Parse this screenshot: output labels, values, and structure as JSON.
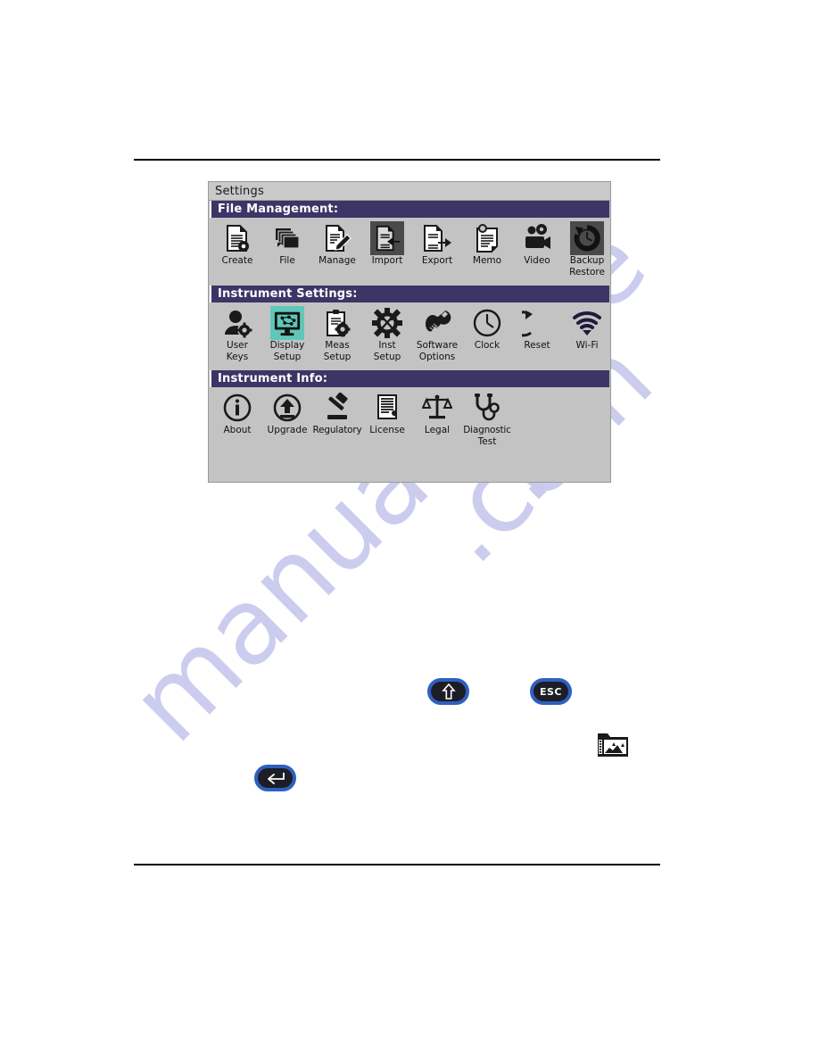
{
  "page": {
    "watermark_line1": "manualshive",
    "watermark_line2": ".com"
  },
  "screen": {
    "title": "Settings",
    "sections": [
      {
        "id": "file-management",
        "header": "File Management:",
        "items": [
          {
            "label": "Create",
            "label2": "",
            "icon": "create-document-icon",
            "state": "normal"
          },
          {
            "label": "File",
            "label2": "",
            "icon": "file-stack-icon",
            "state": "normal"
          },
          {
            "label": "Manage",
            "label2": "",
            "icon": "manage-edit-icon",
            "state": "normal"
          },
          {
            "label": "Import",
            "label2": "",
            "icon": "import-arrow-icon",
            "state": "selected-dark"
          },
          {
            "label": "Export",
            "label2": "",
            "icon": "export-arrow-icon",
            "state": "normal"
          },
          {
            "label": "Memo",
            "label2": "",
            "icon": "memo-pen-icon",
            "state": "normal"
          },
          {
            "label": "Video",
            "label2": "",
            "icon": "video-camera-icon",
            "state": "normal"
          },
          {
            "label": "Backup",
            "label2": "Restore",
            "icon": "backup-restore-icon",
            "state": "selected-dark"
          }
        ]
      },
      {
        "id": "instrument-settings",
        "header": "Instrument Settings:",
        "items": [
          {
            "label": "User",
            "label2": "Keys",
            "icon": "user-gear-icon",
            "state": "normal"
          },
          {
            "label": "Display",
            "label2": "Setup",
            "icon": "display-monitor-icon",
            "state": "selected-teal"
          },
          {
            "label": "Meas",
            "label2": "Setup",
            "icon": "clipboard-gear-icon",
            "state": "normal"
          },
          {
            "label": "Inst",
            "label2": "Setup",
            "icon": "gear-tools-icon",
            "state": "normal"
          },
          {
            "label": "Software",
            "label2": "Options",
            "icon": "hand-wrench-icon",
            "state": "normal"
          },
          {
            "label": "Clock",
            "label2": "",
            "icon": "clock-icon",
            "state": "normal"
          },
          {
            "label": "Reset",
            "label2": "",
            "icon": "reset-arrow-icon",
            "state": "normal"
          },
          {
            "label": "Wi-Fi",
            "label2": "",
            "icon": "wifi-icon",
            "state": "normal"
          }
        ]
      },
      {
        "id": "instrument-info",
        "header": "Instrument Info:",
        "items": [
          {
            "label": "About",
            "label2": "",
            "icon": "info-circle-icon",
            "state": "normal"
          },
          {
            "label": "Upgrade",
            "label2": "",
            "icon": "upgrade-arrow-icon",
            "state": "normal"
          },
          {
            "label": "Regulatory",
            "label2": "",
            "icon": "gavel-icon",
            "state": "normal"
          },
          {
            "label": "License",
            "label2": "",
            "icon": "certificate-icon",
            "state": "normal"
          },
          {
            "label": "Legal",
            "label2": "",
            "icon": "scales-icon",
            "state": "normal"
          },
          {
            "label": "Diagnostic",
            "label2": "Test",
            "icon": "stethoscope-icon",
            "state": "normal"
          }
        ]
      }
    ]
  },
  "keys": [
    {
      "id": "up-key",
      "label": "",
      "icon": "arrow-up-icon"
    },
    {
      "id": "esc-key",
      "label": "ESC",
      "icon": ""
    },
    {
      "id": "enter-key",
      "label": "",
      "icon": "enter-arrow-icon"
    }
  ],
  "capture": {
    "icon": "screen-capture-icon"
  },
  "colors": {
    "section_header_bg": "#3c3566",
    "panel_bg": "#c3c3c3",
    "titlebar_bg": "#c9c9c9",
    "selected_teal": "#5fc7b8",
    "selected_dark": "#4a4a4a",
    "key_border": "#2f5fc0",
    "key_bg": "#1d1d26",
    "watermark": "#c9caee"
  }
}
